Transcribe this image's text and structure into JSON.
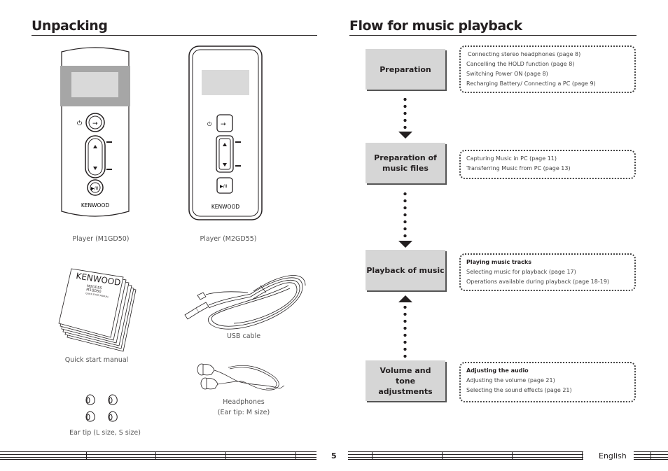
{
  "left_page": {
    "title": "Unpacking",
    "items": [
      {
        "caption": "Player (M1GD50)",
        "icon": "player-m1gd50-illustration"
      },
      {
        "caption": "Player (M2GD55)",
        "icon": "player-m2gd55-illustration"
      },
      {
        "caption": "Quick start manual",
        "icon": "manual-illustration"
      },
      {
        "caption": "USB cable",
        "icon": "usb-cable-illustration"
      },
      {
        "caption_lines": [
          "Headphones",
          "(Ear tip: M size)"
        ],
        "icon": "headphones-illustration"
      },
      {
        "caption": "Ear tip (L size, S size)",
        "icon": "ear-tip-illustration"
      }
    ],
    "device_brand": "KENWOOD",
    "manual_cover": {
      "brand": "KENWOOD",
      "models": [
        "M2GD55",
        "M1GD50"
      ],
      "subtitle": "QUICK START MANUAL"
    }
  },
  "right_page": {
    "title": "Flow for music playback",
    "steps": [
      {
        "label": "Preparation",
        "notes": {
          "heading": null,
          "lines": [
            "Connecting stereo headphones (page 8)",
            "Cancelling the HOLD function (page 8)",
            "Switching Power ON (page 8)",
            "Recharging Battery/ Connecting a PC (page 9)"
          ]
        }
      },
      {
        "label": "Preparation of music files",
        "notes": {
          "heading": null,
          "lines": [
            "Capturing Music in PC (page 11)",
            "Transferring Music from PC (page 13)"
          ]
        }
      },
      {
        "label": "Playback of music",
        "notes": {
          "heading": "Playing music tracks",
          "lines": [
            "Selecting music for playback (page 17)",
            "Operations available during playback (page 18-19)"
          ]
        }
      },
      {
        "label": "Volume and tone adjustments",
        "notes": {
          "heading": "Adjusting the audio",
          "lines": [
            "Adjusting the volume (page 21)",
            "Selecting the sound effects (page 21)"
          ]
        }
      }
    ]
  },
  "footer": {
    "page_number": "5",
    "language": "English"
  },
  "colors": {
    "text": "#231f20",
    "flow_box_fill": "#d6d6d6",
    "device_screen": "#d9d9d9",
    "device_band": "#a6a6a6"
  }
}
